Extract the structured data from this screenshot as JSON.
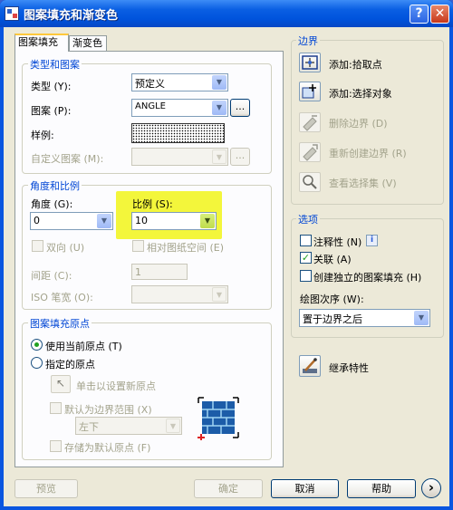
{
  "window": {
    "title": "图案填充和渐变色"
  },
  "tabs": [
    {
      "label": "图案填充"
    },
    {
      "label": "渐变色"
    }
  ],
  "type_pattern": {
    "group_label": "类型和图案",
    "type_label": "类型 (Y):",
    "type_value": "预定义",
    "pattern_label": "图案 (P):",
    "pattern_value": "ANGLE",
    "pattern_browse": "...",
    "swatch_label": "样例:",
    "custom_label": "自定义图案 (M):",
    "custom_browse": "..."
  },
  "angle_scale": {
    "group_label": "角度和比例",
    "angle_label": "角度 (G):",
    "angle_value": "0",
    "scale_label": "比例 (S):",
    "scale_value": "10",
    "double_label": "双向 (U)",
    "relative_label": "相对图纸空间 (E)",
    "spacing_label": "间距 (C):",
    "spacing_value": "1",
    "iso_label": "ISO 笔宽 (O):"
  },
  "origin": {
    "group_label": "图案填充原点",
    "use_current_label": "使用当前原点 (T)",
    "specified_label": "指定的原点",
    "click_set_label": "单击以设置新原点",
    "default_extents_label": "默认为边界范围 (X)",
    "position_value": "左下",
    "store_default_label": "存储为默认原点 (F)"
  },
  "boundaries": {
    "group_label": "边界",
    "add_pick_label": "添加:拾取点",
    "add_select_label": "添加:选择对象",
    "remove_label": "删除边界 (D)",
    "recreate_label": "重新创建边界 (R)",
    "view_label": "查看选择集 (V)"
  },
  "options": {
    "group_label": "选项",
    "annotative_label": "注释性 (N)",
    "info_icon": "i",
    "associative_label": "关联 (A)",
    "associative_checked": true,
    "separate_label": "创建独立的图案填充 (H)",
    "draw_order_label": "绘图次序 (W):",
    "draw_order_value": "置于边界之后"
  },
  "inherit_label": "继承特性",
  "footer": {
    "preview": "预览",
    "ok": "确定",
    "cancel": "取消",
    "help": "帮助",
    "more": "›"
  },
  "colors": {
    "highlight": "#f3f63b",
    "group_label": "#0046d5",
    "title_bar": "#0a5fe3"
  }
}
